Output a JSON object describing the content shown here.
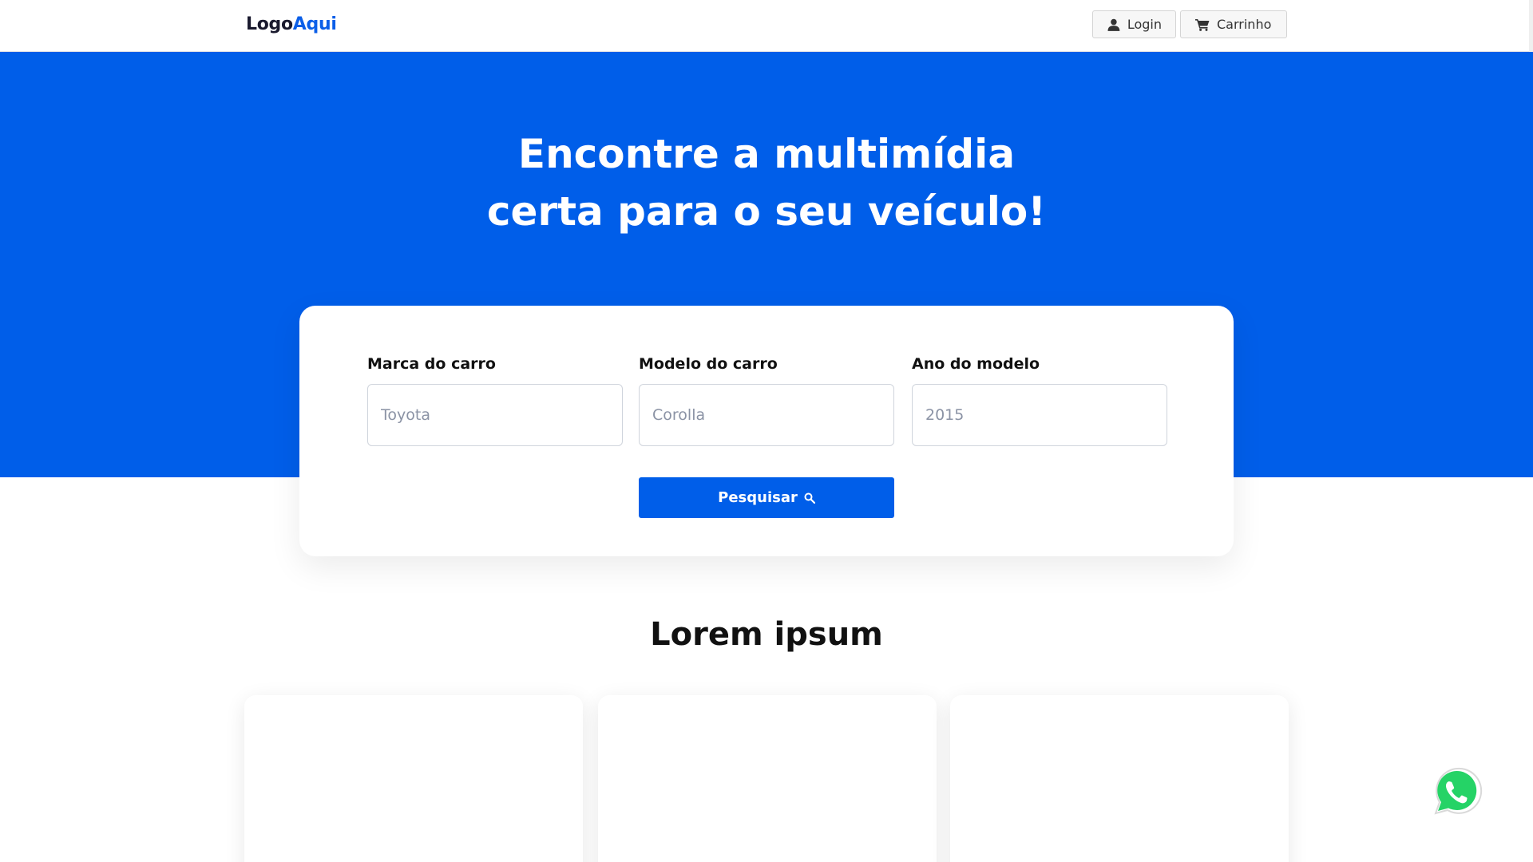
{
  "header": {
    "logo_part1": "Logo",
    "logo_part2": "Aqui",
    "login_label": "Login",
    "cart_label": "Carrinho"
  },
  "hero": {
    "title_line1": "Encontre a multimídia",
    "title_line2": "certa para o seu veículo!"
  },
  "search": {
    "brand_label": "Marca do carro",
    "brand_placeholder": "Toyota",
    "model_label": "Modelo do carro",
    "model_placeholder": "Corolla",
    "year_label": "Ano do modelo",
    "year_placeholder": "2015",
    "button_label": "Pesquisar"
  },
  "section": {
    "title": "Lorem ipsum"
  },
  "colors": {
    "brand_blue": "#005ee9",
    "whatsapp_green": "#25d366"
  },
  "icons": {
    "login": "user-icon",
    "cart": "cart-icon",
    "search": "search-icon",
    "whatsapp": "whatsapp-icon"
  }
}
